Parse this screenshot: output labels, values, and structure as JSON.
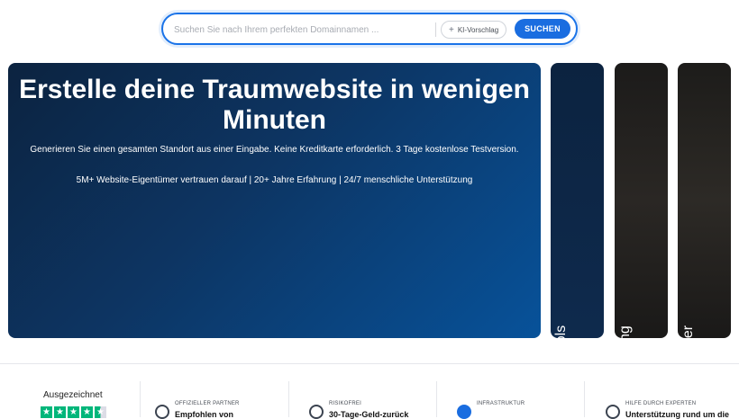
{
  "search": {
    "placeholder": "Suchen Sie nach Ihrem perfekten Domainnamen ...",
    "ai_chip_icon": "+",
    "ai_chip_label": "KI-Vorschlag",
    "button_label": "SUCHEN",
    "accent_color": "#1a6de0"
  },
  "hero": {
    "title": "Erstelle deine Traumwebsite in wenigen Minuten",
    "subtitle": "Generieren Sie einen gesamten Standort aus einer Eingabe. Keine Kreditkarte erforderlich. 3 Tage kostenlose Testversion.",
    "trust_line": "5M+ Website-Eigentümer vertrauen darauf | 20+ Jahre Erfahrung | 24/7 menschliche Unterstützung"
  },
  "side_cards": [
    {
      "label": "KI-Tools"
    },
    {
      "label": "Webhosting"
    },
    {
      "label": "Entwickler"
    }
  ],
  "rating": {
    "label": "Ausgezeichnet",
    "stars": [
      "★",
      "★",
      "★",
      "★",
      "★"
    ],
    "star_color": "#00b67a"
  },
  "features": [
    {
      "heading": "OFFIZIELLER PARTNER",
      "text": "Empfohlen von",
      "icon": "wordpress-icon"
    },
    {
      "heading": "RISIKOFREI",
      "text": "30-Tage-Geld-zurück",
      "icon": "refund-icon"
    },
    {
      "heading": "INFRASTRUKTUR",
      "text": "",
      "icon": "check-shield-icon"
    },
    {
      "heading": "HILFE DURCH EXPERTEN",
      "text": "Unterstützung rund um die",
      "icon": "support-icon"
    }
  ]
}
